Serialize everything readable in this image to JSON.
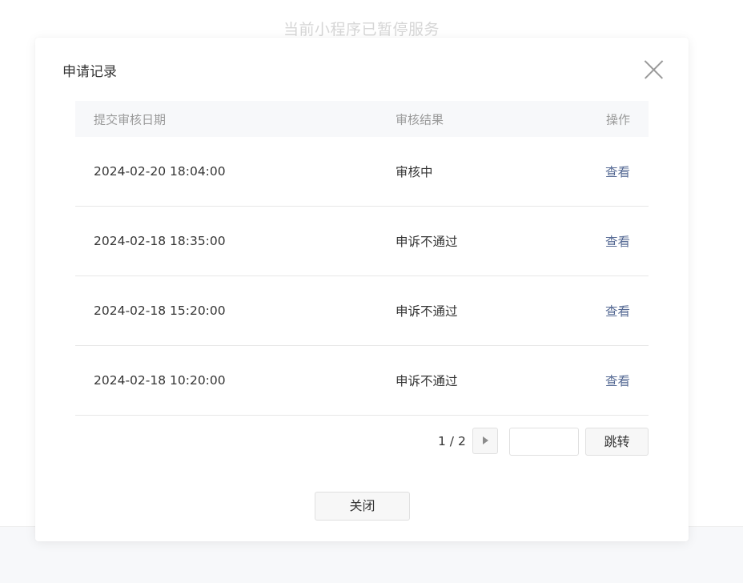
{
  "background": {
    "title": "当前小程序已暂停服务"
  },
  "dialog": {
    "title": "申请记录",
    "table": {
      "headers": [
        "提交审核日期",
        "审核结果",
        "操作"
      ],
      "rows": [
        {
          "date": "2024-02-20 18:04:00",
          "result": "审核中",
          "action": "查看"
        },
        {
          "date": "2024-02-18 18:35:00",
          "result": "申诉不通过",
          "action": "查看"
        },
        {
          "date": "2024-02-18 15:20:00",
          "result": "申诉不通过",
          "action": "查看"
        },
        {
          "date": "2024-02-18 10:20:00",
          "result": "申诉不通过",
          "action": "查看"
        }
      ]
    },
    "pagination": {
      "text": "1 / 2",
      "input_value": "",
      "jump_label": "跳转"
    },
    "close_label": "关闭"
  },
  "colors": {
    "link": "#576b95",
    "header_bg": "#f7f8fa",
    "muted_text": "#9a9a9a"
  },
  "icons": {
    "close": "close-icon",
    "next_page": "caret-right-icon"
  }
}
